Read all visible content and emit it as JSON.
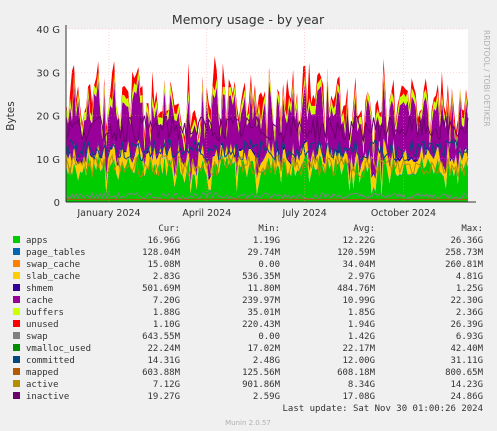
{
  "chart_data": {
    "type": "area",
    "title": "Memory usage - by year",
    "ylabel": "Bytes",
    "side_label": "RRDTOOL / TOBI OETIKER",
    "yticks": [
      "0",
      "10 G",
      "20 G",
      "30 G",
      "40 G"
    ],
    "ytick_values": [
      0,
      10,
      20,
      30,
      40
    ],
    "ylim": [
      0,
      40
    ],
    "xticks": [
      "January 2024",
      "April 2024",
      "July 2024",
      "October 2024"
    ],
    "xtick_dates": [
      "2024-01-01",
      "2024-04-01",
      "2024-07-01",
      "2024-10-01"
    ],
    "x_start": "2023-11-22",
    "x_end": "2024-11-30",
    "grid": true,
    "legend_position": "bottom",
    "column_headers": [
      "Cur:",
      "Min:",
      "Avg:",
      "Max:"
    ],
    "series": [
      {
        "name": "apps",
        "color": "#00cc00",
        "cur": "16.96G",
        "min": "1.19G",
        "avg": "12.22G",
        "max": "26.36G"
      },
      {
        "name": "page_tables",
        "color": "#0066b3",
        "cur": "128.04M",
        "min": "29.74M",
        "avg": "120.59M",
        "max": "258.73M"
      },
      {
        "name": "swap_cache",
        "color": "#ff8000",
        "cur": "15.08M",
        "min": "0.00",
        "avg": "34.04M",
        "max": "260.81M"
      },
      {
        "name": "slab_cache",
        "color": "#ffcc00",
        "cur": "2.83G",
        "min": "536.35M",
        "avg": "2.97G",
        "max": "4.81G"
      },
      {
        "name": "shmem",
        "color": "#330099",
        "cur": "501.69M",
        "min": "11.80M",
        "avg": "484.76M",
        "max": "1.25G"
      },
      {
        "name": "cache",
        "color": "#990099",
        "cur": "7.20G",
        "min": "239.97M",
        "avg": "10.99G",
        "max": "22.30G"
      },
      {
        "name": "buffers",
        "color": "#ccff00",
        "cur": "1.88G",
        "min": "35.01M",
        "avg": "1.85G",
        "max": "2.36G"
      },
      {
        "name": "unused",
        "color": "#ff0000",
        "cur": "1.10G",
        "min": "220.43M",
        "avg": "1.94G",
        "max": "26.39G"
      },
      {
        "name": "swap",
        "color": "#808080",
        "cur": "643.55M",
        "min": "0.00",
        "avg": "1.42G",
        "max": "6.93G"
      },
      {
        "name": "vmalloc_used",
        "color": "#008f00",
        "cur": "22.24M",
        "min": "17.02M",
        "avg": "22.17M",
        "max": "42.40M"
      },
      {
        "name": "committed",
        "color": "#00487d",
        "cur": "14.31G",
        "min": "2.48G",
        "avg": "12.00G",
        "max": "31.11G"
      },
      {
        "name": "mapped",
        "color": "#b35a00",
        "cur": "603.88M",
        "min": "125.56M",
        "avg": "608.18M",
        "max": "800.65M"
      },
      {
        "name": "active",
        "color": "#b38f00",
        "cur": "7.12G",
        "min": "901.86M",
        "avg": "8.34G",
        "max": "14.23G"
      },
      {
        "name": "inactive",
        "color": "#6b006b",
        "cur": "19.27G",
        "min": "2.59G",
        "avg": "17.08G",
        "max": "24.86G"
      }
    ],
    "last_update": "Last update: Sat Nov 30 01:00:26 2024",
    "footer": "Munin 2.0.57"
  }
}
